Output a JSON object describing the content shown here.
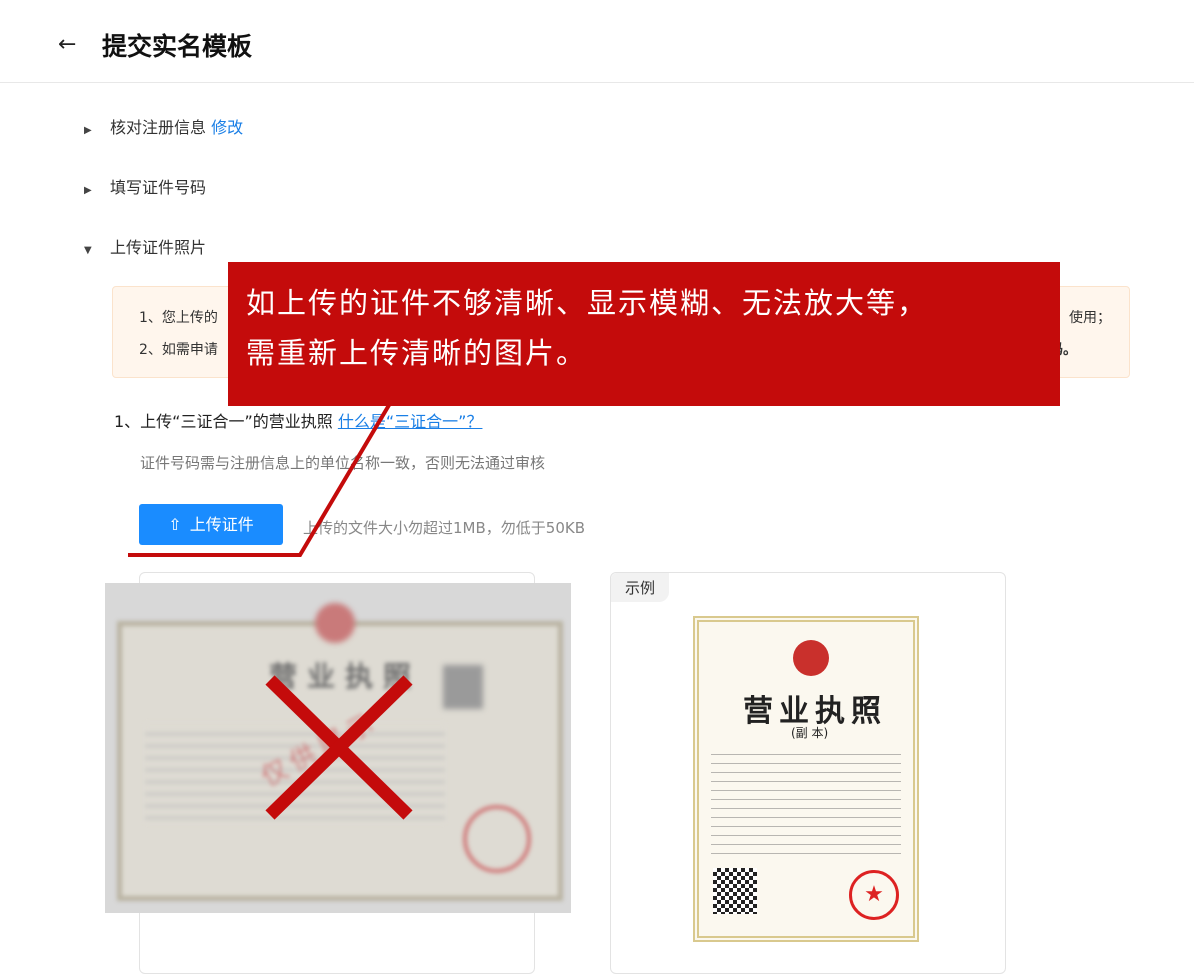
{
  "header": {
    "back_icon": "arrow-left-icon",
    "back_glyph": "←",
    "title": "提交实名模板"
  },
  "steps": [
    {
      "label": "核对注册信息",
      "link": "修改",
      "expanded": false,
      "arrow": "▶"
    },
    {
      "label": "填写证件号码",
      "expanded": false,
      "arrow": "▶"
    },
    {
      "label": "上传证件照片",
      "expanded": true,
      "arrow": "▼"
    }
  ],
  "notice": {
    "line1": "1、您上传的",
    "line1_end": "使用；",
    "line2": "2、如需申请",
    "line2_end": "码。"
  },
  "upload": {
    "heading": "1、上传“三证合一”的营业执照",
    "heading_link": "什么是“三证合一”？",
    "hint": "证件号码需与注册信息上的单位名称一致，否则无法通过审核",
    "button_label": "上传证件",
    "button_icon": "upload-icon",
    "button_glyph": "⇧",
    "note": "上传的文件大小勿超过1MB，勿低于50KB"
  },
  "uploaded_image": {
    "title": "营业执照",
    "stamp_text": "仅供展示"
  },
  "sample_card": {
    "tag": "示例",
    "doc_title": "营业执照",
    "doc_sub": "(副 本)",
    "seal_star": "★"
  },
  "annotation": {
    "line1": "如上传的证件不够清晰、显示模糊、无法放大等，",
    "line2": "需重新上传清晰的图片。",
    "color": "#c40b0b"
  },
  "colors": {
    "link": "#1a7fe6",
    "primary_button": "#1a8cff",
    "notice_bg": "#fff6ed"
  }
}
